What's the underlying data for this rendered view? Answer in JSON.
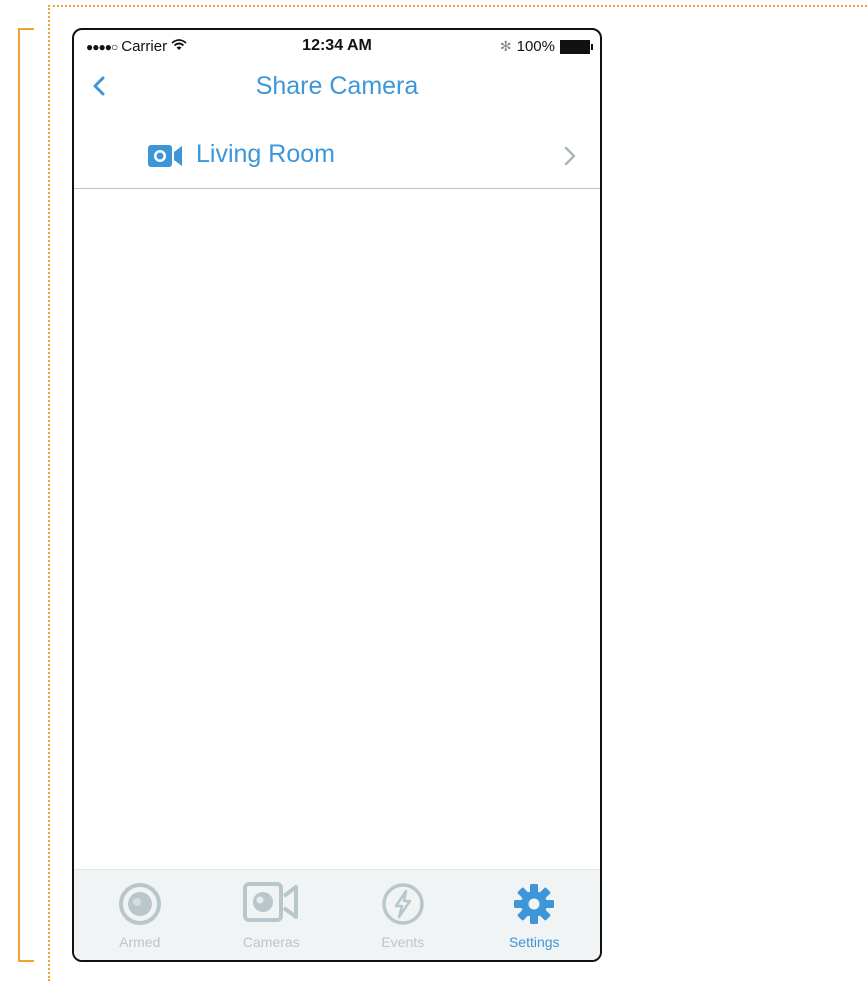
{
  "status": {
    "signal": "●●●●○",
    "carrier": "Carrier",
    "wifi": "ᯤ",
    "time": "12:34 AM",
    "bluetooth": "✻",
    "battery": "100%"
  },
  "nav": {
    "title": "Share Camera"
  },
  "cameras": [
    {
      "label": "Living Room"
    }
  ],
  "tabs": [
    {
      "label": "Armed",
      "icon": "armed-icon",
      "active": false
    },
    {
      "label": "Cameras",
      "icon": "camera-icon",
      "active": false
    },
    {
      "label": "Events",
      "icon": "bolt-icon",
      "active": false
    },
    {
      "label": "Settings",
      "icon": "gear-icon",
      "active": true
    }
  ],
  "colors": {
    "accent": "#3d96d8",
    "inactive": "#b9c6cc",
    "annotation": "#f0a234"
  }
}
